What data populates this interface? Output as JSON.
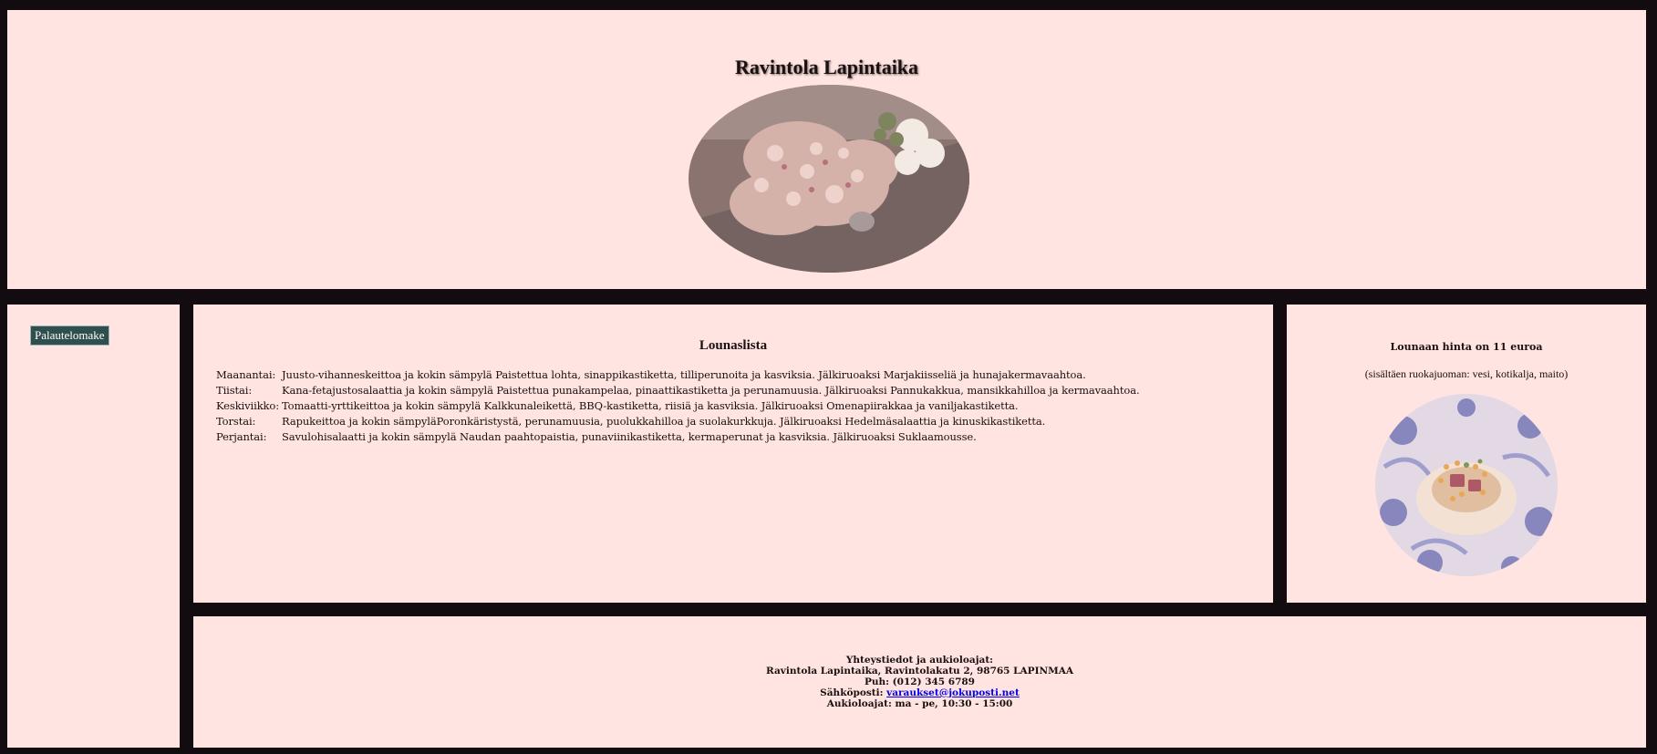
{
  "header": {
    "title": "Ravintola Lapintaika"
  },
  "sidebar": {
    "feedback_label": "Palautelomake"
  },
  "menu": {
    "title": "Lounaslista",
    "days": [
      {
        "day": "Maanantai:",
        "text": "Juusto-vihanneskeittoa ja kokin sämpylä Paistettua lohta, sinappikastiketta, tilliperunoita ja kasviksia. Jälkiruoaksi Marjakiisseliä ja hunajakermavaahtoa."
      },
      {
        "day": "Tiistai:",
        "text": "Kana-fetajustosalaattia ja kokin sämpylä Paistettua punakampelaa, pinaattikastiketta ja perunamuusia. Jälkiruoaksi Pannukakkua, mansikkahilloa ja kermavaahtoa."
      },
      {
        "day": "Keskiviikko:",
        "text": "Tomaatti-yrttikeittoa ja kokin sämpylä Kalkkunaleikettä, BBQ-kastiketta, riisiä ja kasviksia. Jälkiruoaksi Omenapiirakkaa ja vaniljakastiketta."
      },
      {
        "day": "Torstai:",
        "text": "Rapukeittoa ja kokin sämpyläPoronkäristystä, perunamuusia, puolukkahilloa ja suolakurkkuja. Jälkiruoaksi Hedelmäsalaattia ja kinuskikastiketta."
      },
      {
        "day": "Perjantai:",
        "text": "Savulohisalaatti ja kokin sämpylä Naudan paahtopaistia, punaviinikastiketta, kermaperunat ja kasviksia. Jälkiruoaksi Suklaamousse."
      }
    ]
  },
  "price": {
    "heading": "Lounaan hinta on 11 euroa",
    "note": "(sisältäen ruokajuoman: vesi, kotikalja, maito)"
  },
  "footer": {
    "heading": "Yhteystiedot ja aukioloajat:",
    "address": "Ravintola Lapintaika, Ravintolakatu 2, 98765 LAPINMAA",
    "phone": "Puh: (012) 345 6789",
    "email_label": "Sähköposti:",
    "email": "varaukset@jokuposti.net",
    "hours": "Aukioloajat: ma - pe, 10:30 - 15:00"
  },
  "colors": {
    "background": "#120c10",
    "panel": "#ffe4e1",
    "button": "#2f4f4f",
    "link": "#0000ee"
  }
}
